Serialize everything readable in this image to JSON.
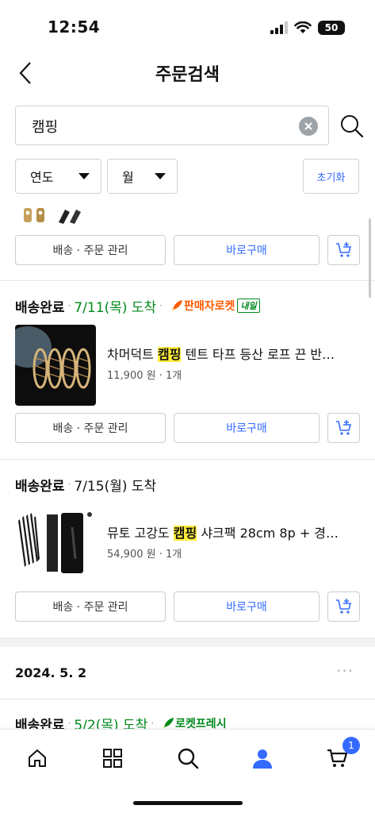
{
  "status_bar": {
    "time": "12:54",
    "battery": "50"
  },
  "header": {
    "title": "주문검색"
  },
  "search": {
    "value": "캠핑"
  },
  "filters": {
    "year": "연도",
    "month": "월",
    "reset": "초기화"
  },
  "buttons": {
    "manage": "배송 · 주문 관리",
    "rebuy": "바로구매"
  },
  "orders": [
    {
      "status": "배송완료",
      "eta": "7/11(목) 도착",
      "badge": "판매자로켓",
      "badge_tag": "내일",
      "product_prefix": "차머덕트 ",
      "product_highlight": "캠핑",
      "product_suffix": " 텐트 타프 등산 로프 끈 반…",
      "price": "11,900 원 · 1개"
    },
    {
      "status": "배송완료",
      "eta": "7/15(월) 도착",
      "product_prefix": "뮤토 고강도 ",
      "product_highlight": "캠핑",
      "product_suffix": " 샤크팩 28cm 8p + 경…",
      "price": "54,900 원 · 1개"
    }
  ],
  "next_group": {
    "date": "2024. 5. 2",
    "status": "배송완료",
    "eta": "5/2(목) 도착",
    "badge": "로켓프레시"
  },
  "bottom_nav": {
    "cart_count": "1"
  },
  "colors": {
    "accent": "#346aff",
    "green": "#00891a",
    "highlight": "#ffed3a",
    "seller_rocket": "#ff5a00"
  }
}
